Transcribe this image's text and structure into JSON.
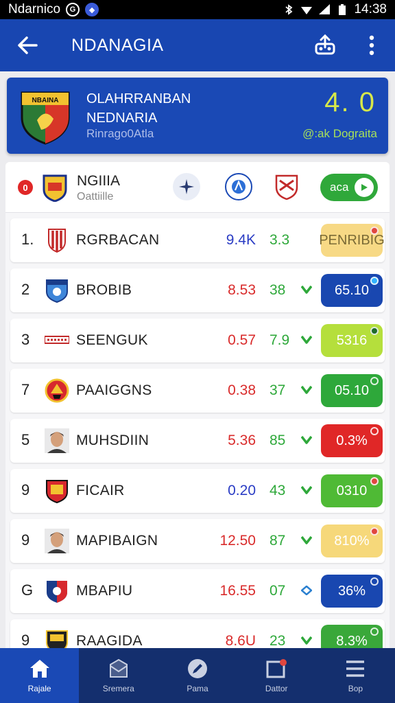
{
  "status_bar": {
    "carrier": "Ndarnico",
    "time": "14:38"
  },
  "app_bar": {
    "title": "NDANAGIA"
  },
  "match": {
    "title_line1": "OLAHRRANBAN",
    "title_line2": "NEDNARIA",
    "subtitle": "Rinrago0Atla",
    "score": "4. 0",
    "score_label": "@:ak Dograita"
  },
  "list_header": {
    "number": "0",
    "title": "NGIIIA",
    "subtitle": "Oattiille",
    "toggle_label": "aca"
  },
  "rows": [
    {
      "rank": "1.",
      "name": "RGRBACAN",
      "stat1": "9.4K",
      "stat1_color": "#2a3cc4",
      "stat2": "3.3",
      "trend": "none",
      "badge": "PENRIBIG",
      "badge_bg": "#f7d985",
      "badge_text_color": "#7a6a35",
      "dot_color": "#e0463f",
      "logo": "shield-red-stripes"
    },
    {
      "rank": "2",
      "name": "BROBIB",
      "stat1": "8.53",
      "stat1_color": "#d92b2b",
      "stat2": "38",
      "trend": "down",
      "badge": "65.10",
      "badge_bg": "#1947b0",
      "badge_text_color": "#ffffff",
      "dot_color": "#33b3ff",
      "logo": "shield-blue"
    },
    {
      "rank": "3",
      "name": "SEENGUK",
      "stat1": "0.57",
      "stat1_color": "#d92b2b",
      "stat2": "7.9",
      "trend": "down",
      "badge": "5316",
      "badge_bg": "#b5df3c",
      "badge_text_color": "#ffffff",
      "dot_color": "#1e6b2a",
      "logo": "banner-red"
    },
    {
      "rank": "7",
      "name": "PAAIGGNS",
      "stat1": "0.38",
      "stat1_color": "#d92b2b",
      "stat2": "37",
      "trend": "down",
      "badge": "05.10",
      "badge_bg": "#2ea83a",
      "badge_text_color": "#ffffff",
      "dot_color": "#2ea83a",
      "logo": "crest-red-gold"
    },
    {
      "rank": "5",
      "name": "MUHSDIIN",
      "stat1": "5.36",
      "stat1_color": "#d92b2b",
      "stat2": "85",
      "trend": "down",
      "badge": "0.3%",
      "badge_bg": "#e02727",
      "badge_text_color": "#ffffff",
      "dot_color": "#e02727",
      "logo": "player-face"
    },
    {
      "rank": "9",
      "name": "FICAIR",
      "stat1": "0.20",
      "stat1_color": "#2a3cc4",
      "stat2": "43",
      "trend": "down",
      "badge": "0310",
      "badge_bg": "#4fba35",
      "badge_text_color": "#ffffff",
      "dot_color": "#e0463f",
      "logo": "shield-red-yellow"
    },
    {
      "rank": "9",
      "name": "MAPIBAIGN",
      "stat1": "12.50",
      "stat1_color": "#d92b2b",
      "stat2": "87",
      "trend": "down",
      "badge": "810%",
      "badge_bg": "#f6d87a",
      "badge_text_color": "#ffffff",
      "dot_color": "#e0463f",
      "logo": "player-face"
    },
    {
      "rank": "G",
      "name": "MBAPIU",
      "stat1": "16.55",
      "stat1_color": "#d92b2b",
      "stat2": "07",
      "trend": "diamond",
      "badge": "36%",
      "badge_bg": "#1947b0",
      "badge_text_color": "#ffffff",
      "dot_color": "#1947b0",
      "logo": "shield-blue-red"
    },
    {
      "rank": "9",
      "name": "RAAGIDA",
      "stat1": "8.6U",
      "stat1_color": "#d92b2b",
      "stat2": "23",
      "trend": "down",
      "badge": "8.3%",
      "badge_bg": "#3aa83a",
      "badge_text_color": "#ffffff",
      "dot_color": "#3aa83a",
      "logo": "crest-dark"
    }
  ],
  "bottom_nav": [
    {
      "label": "Rajale",
      "icon": "home-icon",
      "active": true
    },
    {
      "label": "Sremera",
      "icon": "inbox-icon",
      "active": false
    },
    {
      "label": "Pama",
      "icon": "edit-icon",
      "active": false
    },
    {
      "label": "Dattor",
      "icon": "notification-icon",
      "active": false
    },
    {
      "label": "Bop",
      "icon": "menu-icon",
      "active": false
    }
  ],
  "colors": {
    "primary": "#1a49b5",
    "score": "#d6e84a",
    "stat_positive": "#2ea83a",
    "nav_bg": "#142f6e"
  }
}
